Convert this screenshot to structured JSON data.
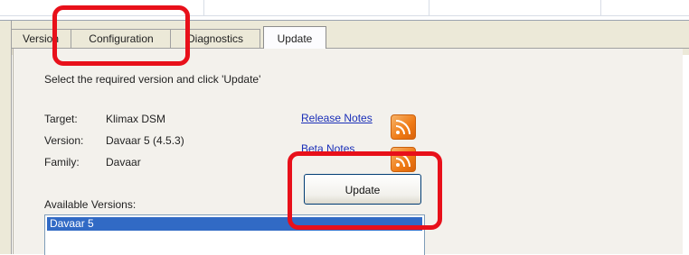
{
  "tabs": [
    {
      "label": "Version",
      "active": false
    },
    {
      "label": "Configuration",
      "active": false
    },
    {
      "label": "Diagnostics",
      "active": false
    },
    {
      "label": "Update",
      "active": true
    }
  ],
  "update_panel": {
    "instruction": "Select the required version and click 'Update'",
    "target_label": "Target:",
    "target_value": "Klimax DSM",
    "version_label": "Version:",
    "version_value": "Davaar 5 (4.5.3)",
    "family_label": "Family:",
    "family_value": "Davaar",
    "release_notes_link": "Release Notes",
    "beta_notes_link": "Beta Notes",
    "update_button": "Update",
    "available_versions_label": "Available Versions:",
    "available_versions": [
      "Davaar 5"
    ],
    "selected_version": "Davaar 5"
  },
  "icons": {
    "release_notes_icon": "rss-feed-icon",
    "beta_notes_icon": "rss-feed-icon"
  },
  "colors": {
    "highlight": "#e8101a",
    "selection": "#316ac5",
    "link": "#1a2fb8"
  }
}
